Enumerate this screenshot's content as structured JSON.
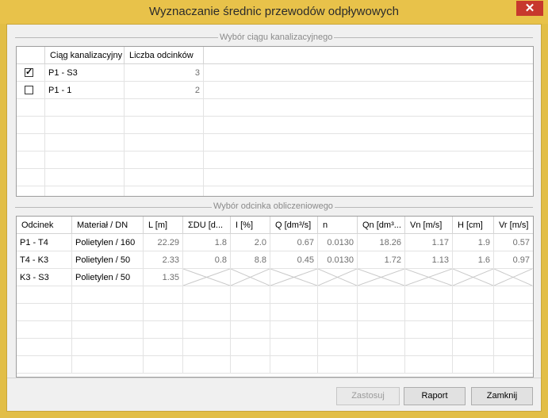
{
  "window": {
    "title": "Wyznaczanie średnic przewodów odpływowych",
    "close_label": "✕"
  },
  "group1": {
    "title": "Wybór ciągu kanalizacyjnego",
    "columns": [
      "Ciąg kanalizacyjny",
      "Liczba odcinków"
    ],
    "rows": [
      {
        "checked": true,
        "name": "P1 - S3",
        "count": "3"
      },
      {
        "checked": false,
        "name": "P1 - 1",
        "count": "2"
      }
    ]
  },
  "group2": {
    "title": "Wybór odcinka obliczeniowego",
    "columns": [
      "Odcinek",
      "Materiał / DN",
      "L [m]",
      "ΣDU [d...",
      "I [%]",
      "Q [dm³/s]",
      "n",
      "Qn [dm³...",
      "Vn [m/s]",
      "H [cm]",
      "Vr [m/s]"
    ],
    "rows": [
      [
        "P1 - T4",
        "Polietylen / 160",
        "22.29",
        "1.8",
        "2.0",
        "0.67",
        "0.0130",
        "18.26",
        "1.17",
        "1.9",
        "0.57"
      ],
      [
        "T4 - K3",
        "Polietylen / 50",
        "2.33",
        "0.8",
        "8.8",
        "0.45",
        "0.0130",
        "1.72",
        "1.13",
        "1.6",
        "0.97"
      ],
      [
        "K3 - S3",
        "Polietylen / 50",
        "1.35",
        "",
        "",
        "",
        "",
        "",
        "",
        "",
        ""
      ]
    ]
  },
  "buttons": {
    "apply": "Zastosuj",
    "report": "Raport",
    "close": "Zamknij"
  }
}
